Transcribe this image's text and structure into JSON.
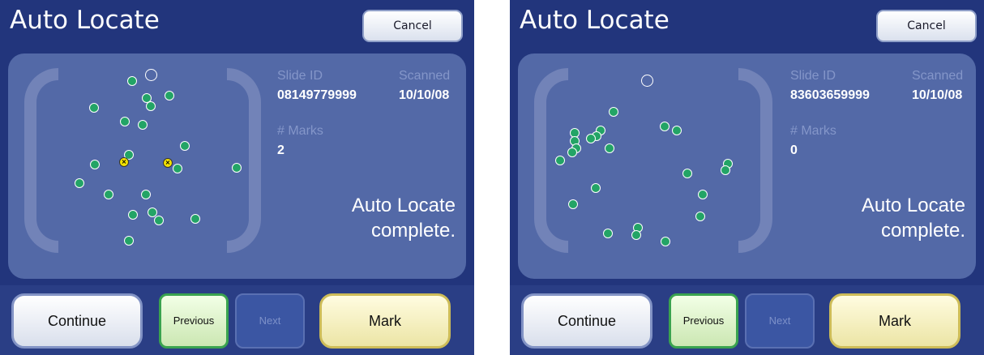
{
  "screens": [
    {
      "title": "Auto Locate",
      "cancel_label": "Cancel",
      "slide_id_label": "Slide ID",
      "slide_id_value": "08149779999",
      "scanned_label": "Scanned",
      "scanned_value": "10/10/08",
      "marks_label": "# Marks",
      "marks_value": "2",
      "message_line1": "Auto Locate",
      "message_line2": "complete.",
      "continue_label": "Continue",
      "previous_label": "Previous",
      "next_label": "Next",
      "mark_label": "Mark"
    },
    {
      "title": "Auto Locate",
      "cancel_label": "Cancel",
      "slide_id_label": "Slide ID",
      "slide_id_value": "83603659999",
      "scanned_label": "Scanned",
      "scanned_value": "10/10/08",
      "marks_label": "# Marks",
      "marks_value": "0",
      "message_line1": "Auto Locate",
      "message_line2": "complete.",
      "continue_label": "Continue",
      "previous_label": "Previous",
      "next_label": "Next",
      "mark_label": "Mark"
    }
  ],
  "colors": {
    "background": "#22357c",
    "panel": "#5369a7",
    "cell_dot": "#23a466",
    "mark_dot": "#f4e200",
    "label_muted": "#8496c9"
  }
}
